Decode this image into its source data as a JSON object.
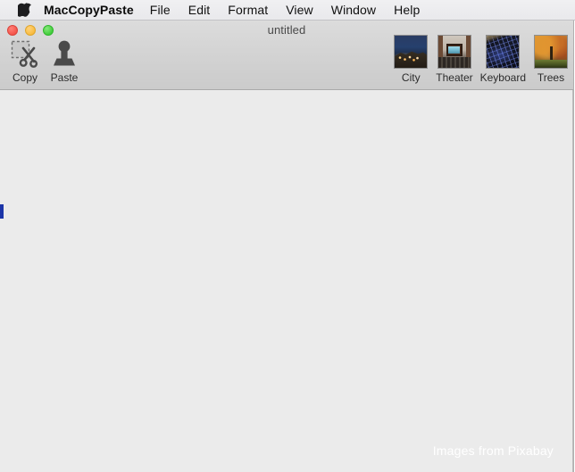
{
  "menubar": {
    "apple_icon": "apple-logo-icon",
    "app_name": "MacCopyPaste",
    "items": [
      {
        "label": "File"
      },
      {
        "label": "Edit"
      },
      {
        "label": "Format"
      },
      {
        "label": "View"
      },
      {
        "label": "Window"
      },
      {
        "label": "Help"
      }
    ]
  },
  "window": {
    "title": "untitled",
    "traffic_lights": [
      {
        "name": "close-button",
        "color": "#f5554b"
      },
      {
        "name": "minimize-button",
        "color": "#f9bc40"
      },
      {
        "name": "maximize-button",
        "color": "#43cd3d"
      }
    ]
  },
  "toolbar": {
    "left_tools": [
      {
        "label": "Copy",
        "icon": "scissors-icon"
      },
      {
        "label": "Paste",
        "icon": "stamp-icon"
      }
    ],
    "thumbnails": [
      {
        "label": "City",
        "art": "art-city"
      },
      {
        "label": "Theater",
        "art": "art-theater"
      },
      {
        "label": "Keyboard",
        "art": "art-keyboard"
      },
      {
        "label": "Trees",
        "art": "art-trees"
      }
    ]
  },
  "content": {
    "text": "",
    "caret_color": "#1c35a8",
    "watermark": "Images from Pixabay"
  }
}
